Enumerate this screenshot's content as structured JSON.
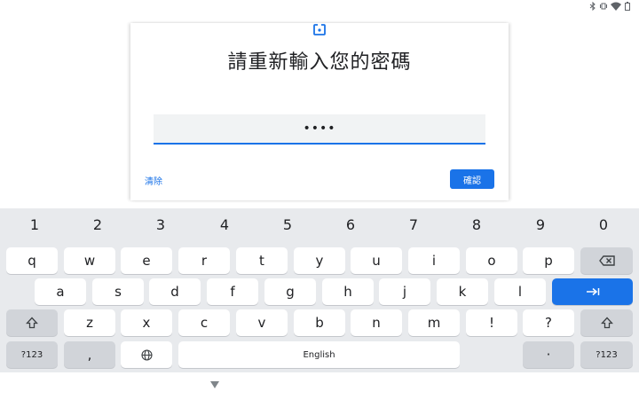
{
  "status_bar": {
    "icons": [
      "bluetooth-icon",
      "vibrate-icon",
      "wifi-icon",
      "battery-icon"
    ]
  },
  "dialog": {
    "lock_icon": "lock-icon",
    "title": "請重新輸入您的密碼",
    "password_masked": "••••",
    "clear_label": "清除",
    "confirm_label": "確認"
  },
  "keyboard": {
    "numbers": [
      "1",
      "2",
      "3",
      "4",
      "5",
      "6",
      "7",
      "8",
      "9",
      "0"
    ],
    "row1": [
      "q",
      "w",
      "e",
      "r",
      "t",
      "y",
      "u",
      "i",
      "o",
      "p"
    ],
    "row2": [
      "a",
      "s",
      "d",
      "f",
      "g",
      "h",
      "j",
      "k",
      "l"
    ],
    "row3": [
      "z",
      "x",
      "c",
      "v",
      "b",
      "n",
      "m",
      "!",
      "?"
    ],
    "sym_label": "?123",
    "comma_label": ",",
    "space_label": "English",
    "period_label": "·",
    "sym_label_right": "?123"
  },
  "colors": {
    "accent": "#1a73e8",
    "keyboard_bg": "#e8eaed",
    "key_mod": "#d1d4d9"
  }
}
